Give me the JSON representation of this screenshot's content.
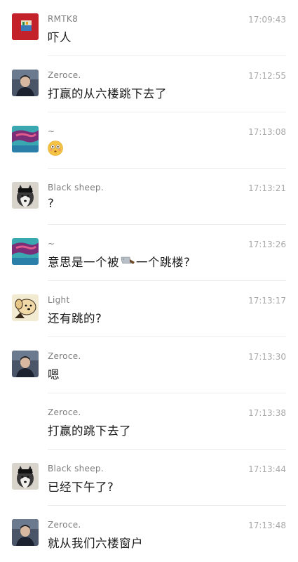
{
  "messages": [
    {
      "name": "RMTK8",
      "time": "17:09:43",
      "text": "吓人",
      "avatar": "rmtk8-avatar",
      "emoji": ""
    },
    {
      "name": "Zeroce.",
      "time": "17:12:55",
      "text": "打赢的从六楼跳下去了",
      "avatar": "zeroce-avatar",
      "emoji": ""
    },
    {
      "name": "~",
      "time": "17:13:08",
      "text": "",
      "avatar": "tilde-avatar",
      "emoji": "flushed-face-icon"
    },
    {
      "name": "Black sheep.",
      "time": "17:13:21",
      "text": "?",
      "avatar": "husky-avatar",
      "emoji": ""
    },
    {
      "name": "~",
      "time": "17:13:26",
      "text_a": "意思是一个被",
      "text_b": "一个跳楼?",
      "avatar": "tilde-avatar",
      "emoji": "kitchen-knife-icon"
    },
    {
      "name": "Light",
      "time": "17:13:17",
      "text": "还有跳的?",
      "avatar": "light-avatar",
      "emoji": ""
    },
    {
      "name": "Zeroce.",
      "time": "17:13:30",
      "text": "嗯",
      "avatar": "zeroce-avatar",
      "emoji": ""
    },
    {
      "name": "Zeroce.",
      "time": "17:13:38",
      "text": "打赢的跳下去了",
      "avatar": "",
      "emoji": ""
    },
    {
      "name": "Black sheep.",
      "time": "17:13:44",
      "text": "已经下午了?",
      "avatar": "husky-avatar",
      "emoji": ""
    },
    {
      "name": "Zeroce.",
      "time": "17:13:48",
      "text": "就从我们六楼窗户",
      "avatar": "zeroce-avatar",
      "emoji": ""
    }
  ]
}
